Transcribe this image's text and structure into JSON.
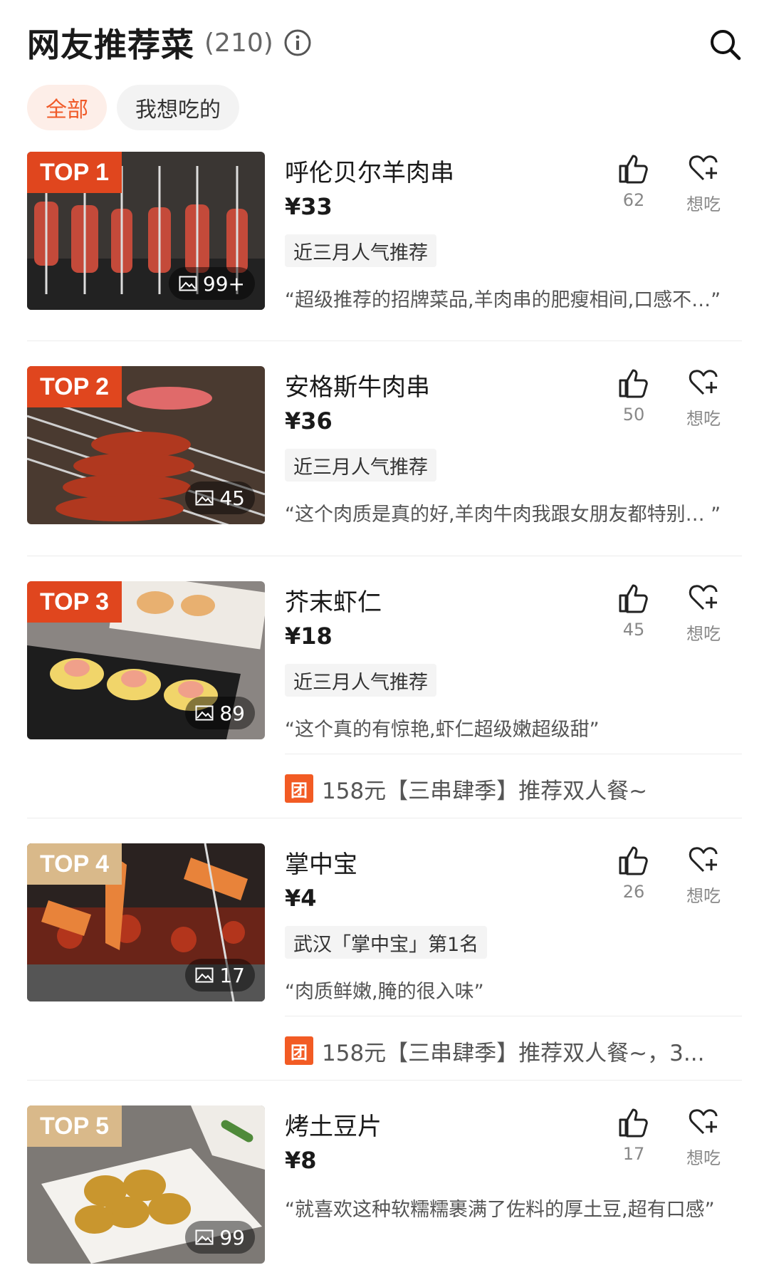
{
  "header": {
    "title": "网友推荐菜",
    "count": "(210)"
  },
  "filters": [
    {
      "label": "全部",
      "active": true
    },
    {
      "label": "我想吃的",
      "active": false
    }
  ],
  "want_label": "想吃",
  "dishes": [
    {
      "rank": "TOP 1",
      "name": "呼伦贝尔羊肉串",
      "price": "¥33",
      "tag": "近三月人气推荐",
      "quote": "“超级推荐的招牌菜品,羊肉串的肥瘦相间,口感不…”",
      "photos": "99+",
      "likes": "62"
    },
    {
      "rank": "TOP 2",
      "name": "安格斯牛肉串",
      "price": "¥36",
      "tag": "近三月人气推荐",
      "quote": "“这个肉质是真的好,羊肉牛肉我跟女朋友都特别… ”",
      "photos": "45",
      "likes": "50"
    },
    {
      "rank": "TOP 3",
      "name": "芥末虾仁",
      "price": "¥18",
      "tag": "近三月人气推荐",
      "quote": "“这个真的有惊艳,虾仁超级嫩超级甜”",
      "photos": "89",
      "likes": "45",
      "deal_icon": "团",
      "deal": "158元【三串肆季】推荐双人餐~"
    },
    {
      "rank": "TOP 4",
      "name": "掌中宝",
      "price": "¥4",
      "tag": "武汉「掌中宝」第1名",
      "quote": "“肉质鲜嫩,腌的很入味”",
      "photos": "17",
      "likes": "26",
      "deal_icon": "团",
      "deal": "158元【三串肆季】推荐双人餐~，3..."
    },
    {
      "rank": "TOP 5",
      "name": "烤土豆片",
      "price": "¥8",
      "quote": "“就喜欢这种软糯糯裹满了佐料的厚土豆,超有口感”",
      "photos": "99",
      "likes": "17"
    }
  ],
  "colors": {
    "accent": "#f05a28",
    "badge_red": "#e0461e",
    "badge_tan": "#d9b98a"
  }
}
